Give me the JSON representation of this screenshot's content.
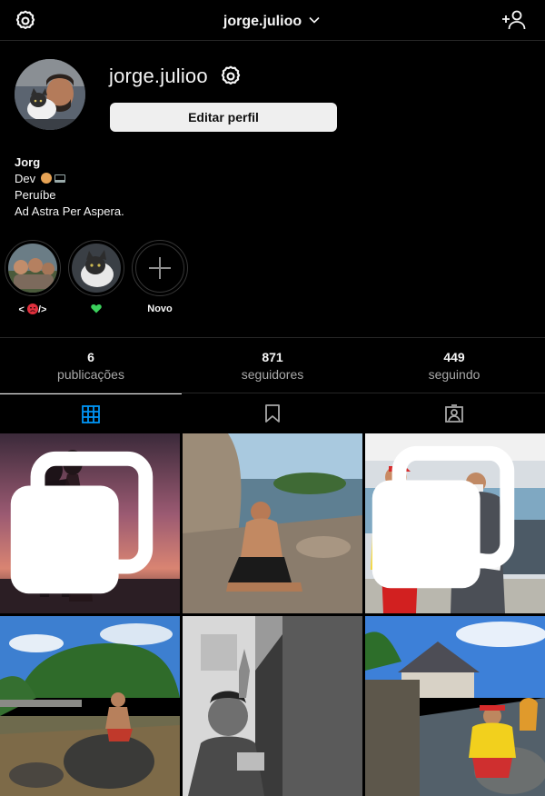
{
  "header": {
    "username": "jorge.julioo",
    "settings_icon": "gear-icon",
    "dropdown_icon": "chevron-down-icon",
    "add_user_icon": "add-user-icon"
  },
  "profile": {
    "username": "jorge.julioo",
    "edit_button": "Editar perfil"
  },
  "bio": {
    "name": "Jorg",
    "line1": "Dev",
    "line2": "Peruíbe",
    "line3": "Ad Astra Per Aspera."
  },
  "highlights": [
    {
      "label_left": "<",
      "label_right": "/>"
    },
    {
      "label": ""
    },
    {
      "label": "Novo"
    }
  ],
  "stats": [
    {
      "value": "6",
      "label": "publicações"
    },
    {
      "value": "871",
      "label": "seguidores"
    },
    {
      "value": "449",
      "label": "seguindo"
    }
  ],
  "tabs": [
    {
      "name": "grid",
      "icon": "grid-icon",
      "active": true
    },
    {
      "name": "saved",
      "icon": "bookmark-icon",
      "active": false
    },
    {
      "name": "tagged",
      "icon": "tagged-icon",
      "active": false
    }
  ],
  "colors": {
    "background": "#000000",
    "accent_blue": "#0095f6",
    "heart_green": "#3bd15c",
    "divider": "#262626",
    "secondary_text": "#a8a8a8"
  }
}
